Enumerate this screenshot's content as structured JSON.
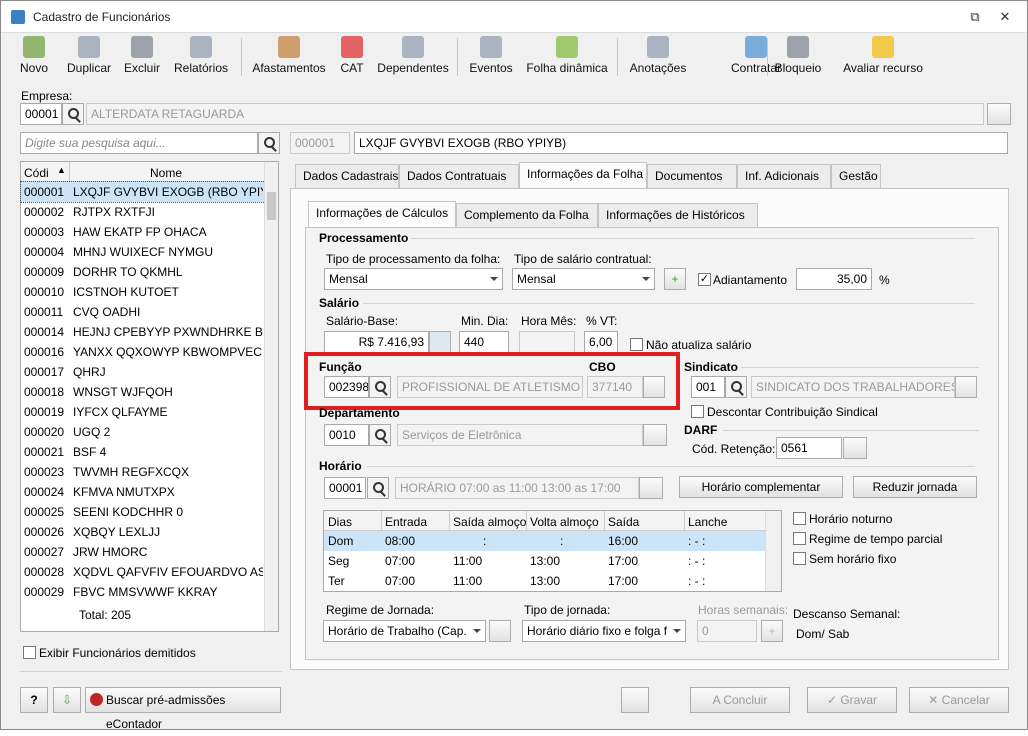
{
  "window": {
    "title": "Cadastro de Funcionários"
  },
  "toolbar": [
    {
      "label": "Novo",
      "icon": "new-user-icon"
    },
    {
      "label": "Duplicar",
      "icon": "duplicate-icon"
    },
    {
      "label": "Excluir",
      "icon": "trash-icon"
    },
    {
      "label": "Relatórios",
      "icon": "report-icon"
    },
    {
      "label": "Afastamentos",
      "icon": "house-icon"
    },
    {
      "label": "CAT",
      "icon": "cross-icon"
    },
    {
      "label": "Dependentes",
      "icon": "people-icon"
    },
    {
      "label": "Eventos",
      "icon": "list-icon"
    },
    {
      "label": "Folha dinâmica",
      "icon": "calc-icon"
    },
    {
      "label": "Anotações",
      "icon": "note-icon"
    },
    {
      "label": "Contratar",
      "icon": "contract-icon"
    },
    {
      "label": "Bloqueio",
      "icon": "lock-icon"
    },
    {
      "label": "Avaliar recurso",
      "icon": "star-icon"
    }
  ],
  "empresa": {
    "label": "Empresa:",
    "code": "00001",
    "name": "ALTERDATA RETAGUARDA"
  },
  "search": {
    "placeholder": "Digite sua pesquisa aqui..."
  },
  "selected": {
    "code": "000001",
    "name": "LXQJF GVYBVI EXOGB (RBO YPIYB)"
  },
  "list": {
    "headers": [
      "Códi",
      "Nome"
    ],
    "rows": [
      [
        "000001",
        "LXQJF GVYBVI EXOGB (RBO YPIYB)"
      ],
      [
        "000002",
        "RJTPX RXTFJI"
      ],
      [
        "000003",
        "HAW EKATP FP OHACA"
      ],
      [
        "000004",
        "MHNJ WUIXECF NYMGU"
      ],
      [
        "000009",
        "DORHR TO QKMHL"
      ],
      [
        "000010",
        "ICSTNOH KUTOET"
      ],
      [
        "000011",
        "CVQ OADHI"
      ],
      [
        "000014",
        "HEJNJ CPEBYYP PXWNDHRKE BTB J"
      ],
      [
        "000016",
        "YANXX QQXOWYP KBWOMPVEC A"
      ],
      [
        "000017",
        "QHRJ"
      ],
      [
        "000018",
        "WNSGT WJFQOH"
      ],
      [
        "000019",
        "IYFCX QLFAYME"
      ],
      [
        "000020",
        "UGQ 2"
      ],
      [
        "000021",
        "BSF 4"
      ],
      [
        "000023",
        "TWVMH REGFXCQX"
      ],
      [
        "000024",
        "KFMVA NMUTXPX"
      ],
      [
        "000025",
        "SEENI KODCHHR 0"
      ],
      [
        "000026",
        "XQBQY LEXLJJ"
      ],
      [
        "000027",
        "JRW HMORC"
      ],
      [
        "000028",
        "XQDVL QAFVFIV EFOUARDVO AST U"
      ],
      [
        "000029",
        "FBVC MMSVWWF KKRAY"
      ]
    ],
    "total": "Total: 205",
    "show_dismissed": "Exibir Funcionários demitidos"
  },
  "main_tabs": [
    "Dados Cadastrais",
    "Dados Contratuais",
    "Informações da Folha",
    "Documentos",
    "Inf. Adicionais",
    "Gestão"
  ],
  "sub_tabs": [
    "Informações de Cálculos",
    "Complemento da Folha",
    "Informações de  Históricos"
  ],
  "processamento": {
    "title": "Processamento",
    "tipo_proc_label": "Tipo de processamento da folha:",
    "tipo_proc": "Mensal",
    "tipo_sal_label": "Tipo de salário contratual:",
    "tipo_sal": "Mensal",
    "adiantamento_label": "Adiantamento",
    "adiantamento_value": "35,00",
    "pct": "%"
  },
  "salario": {
    "title": "Salário",
    "base_label": "Salário-Base:",
    "base": "R$ 7.416,93",
    "min_dia_label": "Min. Dia:",
    "min_dia": "440",
    "hora_mes_label": "Hora Mês:",
    "hora_mes": "",
    "vt_label": "% VT:",
    "vt": "6,00",
    "nao_atualiza": "Não atualiza salário"
  },
  "funcao": {
    "title": "Função",
    "code": "002398",
    "name": "PROFISSIONAL DE ATLETISMO",
    "cbo_title": "CBO",
    "cbo": "377140"
  },
  "sindicato": {
    "title": "Sindicato",
    "code": "001",
    "name": "SINDICATO DOS TRABALHADORES DE",
    "descontar": "Descontar Contribuição Sindical"
  },
  "departamento": {
    "title": "Departamento",
    "code": "0010",
    "name": "Serviços de Eletrônica"
  },
  "darf": {
    "title": "DARF",
    "label": "Cód. Retenção:",
    "value": "0561"
  },
  "horario": {
    "title": "Horário",
    "code": "00001",
    "name": "HORÁRIO 07:00 as 11:00  13:00 as 17:00",
    "complementar": "Horário complementar",
    "reduzir": "Reduzir jornada",
    "headers": [
      "Dias",
      "Entrada",
      "Saída almoço",
      "Volta almoço",
      "Saída",
      "Lanche"
    ],
    "rows": [
      [
        "Dom",
        "08:00",
        ":",
        ":",
        "16:00",
        ":  -  :"
      ],
      [
        "Seg",
        "07:00",
        "11:00",
        "13:00",
        "17:00",
        ":  -  :"
      ],
      [
        "Ter",
        "07:00",
        "11:00",
        "13:00",
        "17:00",
        ":  -  :"
      ]
    ],
    "noturno": "Horário noturno",
    "parcial": "Regime de tempo parcial",
    "sem_fixo": "Sem horário fixo"
  },
  "regime": {
    "label": "Regime de Jornada:",
    "value": "Horário de Trabalho (Cap.",
    "tipo_label": "Tipo de jornada:",
    "tipo_value": "Horário diário fixo e folga f",
    "horas_label": "Horas semanais:",
    "horas_value": "0",
    "descanso_label": "Descanso Semanal:",
    "descanso_value": "Dom/ Sab"
  },
  "footer": {
    "buscar": "Buscar pré-admissões eContador",
    "concluir": "A Concluir",
    "gravar": "Gravar",
    "cancelar": "Cancelar"
  }
}
